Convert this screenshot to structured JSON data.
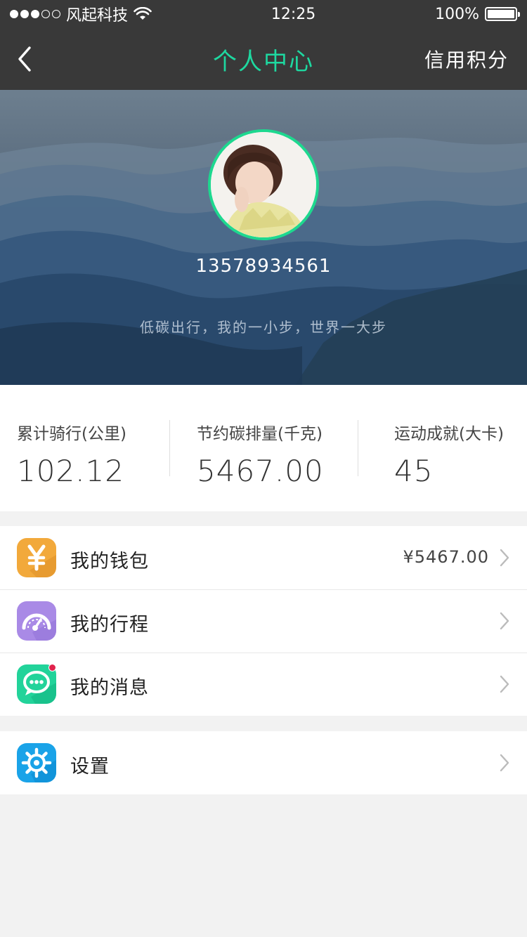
{
  "status_bar": {
    "carrier": "风起科技",
    "time": "12:25",
    "battery": "100%"
  },
  "nav": {
    "title": "个人中心",
    "right_label": "信用积分"
  },
  "profile": {
    "phone": "13578934561",
    "slogan": "低碳出行，我的一小步，世界一大步"
  },
  "stats": [
    {
      "label": "累计骑行(公里)",
      "value": "102.12"
    },
    {
      "label": "节约碳排量(千克)",
      "value": "5467.00"
    },
    {
      "label": "运动成就(大卡)",
      "value": "45"
    }
  ],
  "menu": {
    "wallet": {
      "label": "我的钱包",
      "value": "¥5467.00"
    },
    "trips": {
      "label": "我的行程"
    },
    "messages": {
      "label": "我的消息"
    },
    "settings": {
      "label": "设置"
    }
  },
  "colors": {
    "accent": "#1ed8a0",
    "wallet_icon": "#f2a93b",
    "trips_icon": "#a98ae6",
    "messages_icon": "#22d39a",
    "settings_icon": "#1aa3e8",
    "badge": "#e0234c"
  }
}
